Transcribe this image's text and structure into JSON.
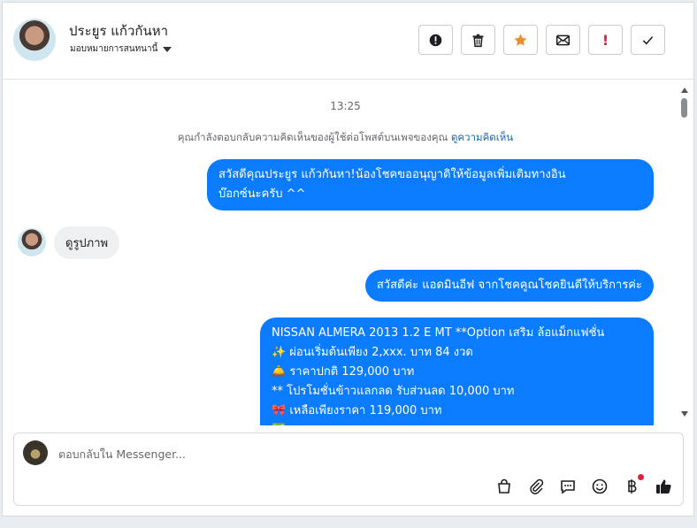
{
  "header": {
    "contact_name": "ประยูร แก้วกันหา",
    "assign_label": "มอบหมายการสนทนานี้"
  },
  "actions": {
    "report_icon": "alert-circle-icon",
    "delete_icon": "trash-icon",
    "star_icon": "star-icon",
    "mail_icon": "envelope-icon",
    "flag_text": "!",
    "done_icon": "check-icon"
  },
  "chat": {
    "timestamp": "13:25",
    "notice_text": "คุณกำลังตอบกลับความคิดเห็นของผู้ใช้ต่อโพสต์บนเพจของคุณ",
    "notice_link": "ดูความคิดเห็น",
    "messages": [
      {
        "direction": "out",
        "lines": [
          "สวัสดีคุณประยูร แก้วกันหา!น้องโชคขออนุญาติให้ข้อมูลเพิ่มเติมทางอิน",
          "บ๊อกซ์นะครับ ^^"
        ]
      },
      {
        "direction": "in",
        "lines": [
          "ดูรูปภาพ"
        ]
      },
      {
        "direction": "out",
        "lines": [
          "สวัสดีค่ะ แอดมินอีฟ จากโชคคูณโชคยินดีให้บริการค่ะ"
        ]
      },
      {
        "direction": "out",
        "lines": [
          "NISSAN ALMERA 2013 1.2 E MT **Option เสริม ล้อแม็กแฟชั่น",
          "✨  ผ่อนเริ่มต้นเพียง 2,xxx. บาท 84 งวด",
          "🛎️   ราคาปกติ 129,000 บาท",
          "** โปรโมชั่นข้าวแลกลด รับส่วนลด 10,000 บาท",
          "🎀  เหลือเพียงราคา 119,000 บาท",
          "✅"
        ]
      }
    ]
  },
  "composer": {
    "placeholder": "ตอบกลับใน Messenger...",
    "tools": [
      "shopping-bag-icon",
      "paperclip-icon",
      "saved-replies-icon",
      "emoji-icon",
      "baht-payment-icon",
      "thumbs-up-icon"
    ]
  },
  "colors": {
    "accent": "#0b7cff",
    "star": "#f28a2a",
    "flag": "#e41e3f"
  }
}
